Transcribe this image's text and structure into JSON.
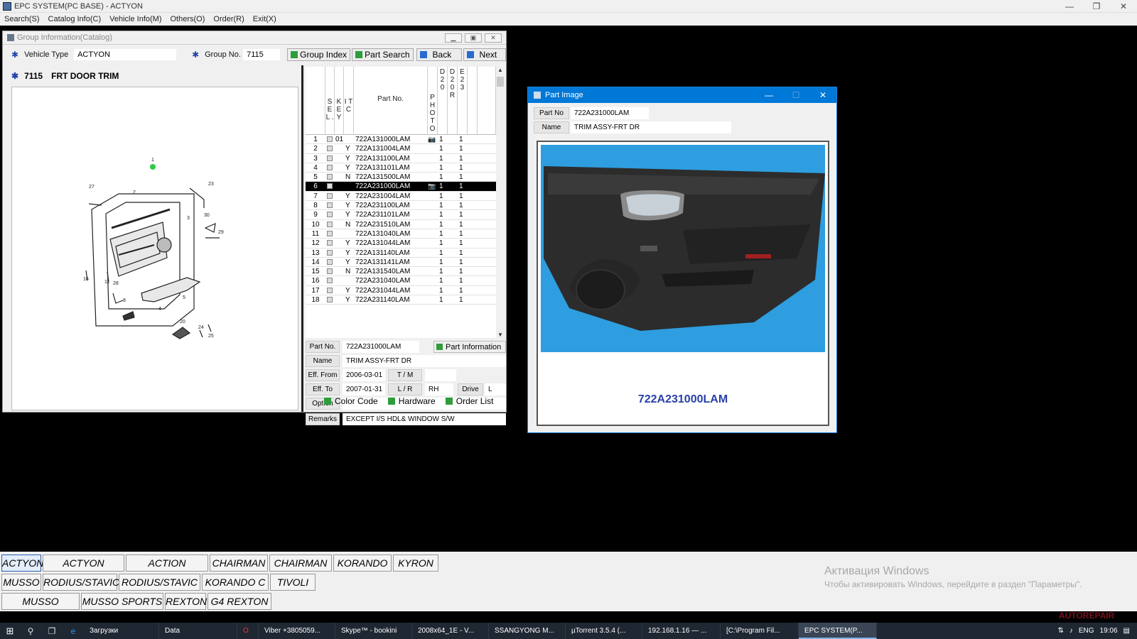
{
  "window": {
    "title": "EPC SYSTEM(PC BASE) - ACTYON",
    "controls": {
      "minimize": "—",
      "restore": "❐",
      "close": "✕"
    }
  },
  "menu": [
    "Search(S)",
    "Catalog Info(C)",
    "Vehicle Info(M)",
    "Others(O)",
    "Order(R)",
    "Exit(X)"
  ],
  "group_window": {
    "title": "Group Information(Catalog)",
    "vehicle_type_label": "Vehicle Type",
    "vehicle_type": "ACTYON",
    "group_no_label": "Group No.",
    "group_no": "7115",
    "buttons": {
      "group_index": "Group Index",
      "part_search": "Part Search",
      "back": "Back",
      "next": "Next"
    },
    "group_code": "7115",
    "group_name": "FRT DOOR TRIM",
    "diagram_labels": {
      "callout_top": "1",
      "n27": "27",
      "n2": "2",
      "n23": "23",
      "n3": "3",
      "n30": "30",
      "n29": "29",
      "n16": "16",
      "n11": "11",
      "n28": "28",
      "n8": "8",
      "n4": "4",
      "n5": "5",
      "n20": "20",
      "n24": "24",
      "n25": "25"
    }
  },
  "parts_table": {
    "headers": {
      "sel": "S E L .",
      "key": "K E Y",
      "itc": "I T C",
      "part_no": "Part No.",
      "photo": "P H O T O",
      "d20": "D 2 0",
      "d20r": "D 2 0 R",
      "e23": "E 2 3"
    },
    "rows": [
      {
        "n": "1",
        "key": "01",
        "itc": "",
        "part": "722A131000LAM",
        "photo": true,
        "d20": "1",
        "e23": "1"
      },
      {
        "n": "2",
        "key": "",
        "itc": "Y",
        "part": "722A131004LAM",
        "photo": false,
        "d20": "1",
        "e23": "1"
      },
      {
        "n": "3",
        "key": "",
        "itc": "Y",
        "part": "722A131100LAM",
        "photo": false,
        "d20": "1",
        "e23": "1"
      },
      {
        "n": "4",
        "key": "",
        "itc": "Y",
        "part": "722A131101LAM",
        "photo": false,
        "d20": "1",
        "e23": "1"
      },
      {
        "n": "5",
        "key": "",
        "itc": "N",
        "part": "722A131500LAM",
        "photo": false,
        "d20": "1",
        "e23": "1"
      },
      {
        "n": "6",
        "key": "",
        "itc": "",
        "part": "722A231000LAM",
        "photo": true,
        "d20": "1",
        "e23": "1",
        "selected": true
      },
      {
        "n": "7",
        "key": "",
        "itc": "Y",
        "part": "722A231004LAM",
        "photo": false,
        "d20": "1",
        "e23": "1"
      },
      {
        "n": "8",
        "key": "",
        "itc": "Y",
        "part": "722A231100LAM",
        "photo": false,
        "d20": "1",
        "e23": "1"
      },
      {
        "n": "9",
        "key": "",
        "itc": "Y",
        "part": "722A231101LAM",
        "photo": false,
        "d20": "1",
        "e23": "1"
      },
      {
        "n": "10",
        "key": "",
        "itc": "N",
        "part": "722A231510LAM",
        "photo": false,
        "d20": "1",
        "e23": "1"
      },
      {
        "n": "11",
        "key": "",
        "itc": "",
        "part": "722A131040LAM",
        "photo": false,
        "d20": "1",
        "e23": "1"
      },
      {
        "n": "12",
        "key": "",
        "itc": "Y",
        "part": "722A131044LAM",
        "photo": false,
        "d20": "1",
        "e23": "1"
      },
      {
        "n": "13",
        "key": "",
        "itc": "Y",
        "part": "722A131140LAM",
        "photo": false,
        "d20": "1",
        "e23": "1"
      },
      {
        "n": "14",
        "key": "",
        "itc": "Y",
        "part": "722A131141LAM",
        "photo": false,
        "d20": "1",
        "e23": "1"
      },
      {
        "n": "15",
        "key": "",
        "itc": "N",
        "part": "722A131540LAM",
        "photo": false,
        "d20": "1",
        "e23": "1"
      },
      {
        "n": "16",
        "key": "",
        "itc": "",
        "part": "722A231040LAM",
        "photo": false,
        "d20": "1",
        "e23": "1"
      },
      {
        "n": "17",
        "key": "",
        "itc": "Y",
        "part": "722A231044LAM",
        "photo": false,
        "d20": "1",
        "e23": "1"
      },
      {
        "n": "18",
        "key": "",
        "itc": "Y",
        "part": "722A231140LAM",
        "photo": false,
        "d20": "1",
        "e23": "1"
      }
    ]
  },
  "detail": {
    "part_no_label": "Part No.",
    "part_no": "722A231000LAM",
    "part_info_button": "Part Information",
    "name_label": "Name",
    "name": "TRIM ASSY-FRT DR",
    "eff_from_label": "Eff. From",
    "eff_from": "2006-03-01",
    "tm_label": "T / M",
    "tm": "",
    "eff_to_label": "Eff. To",
    "eff_to": "2007-01-31",
    "lr_label": "L / R",
    "lr": "RH",
    "drive_label": "Drive",
    "drive": "L",
    "option_label": "Option",
    "option": "",
    "remarks_label": "Remarks",
    "remarks": "EXCEPT I/S HDL& WINDOW S/W",
    "buttons": {
      "color_code": "Color Code",
      "hardware": "Hardware",
      "order_list": "Order List"
    }
  },
  "part_image_window": {
    "title": "Part Image",
    "part_no_label": "Part No",
    "part_no": "722A231000LAM",
    "name_label": "Name",
    "name": "TRIM ASSY-FRT DR",
    "caption": "722A231000LAM"
  },
  "vehicle_tabs": [
    [
      "ACTYON",
      "ACTYON SPORTS",
      "ACTION SPORTS II",
      "CHAIRMAN",
      "CHAIRMAN W",
      "KORANDO",
      "KYRON"
    ],
    [
      "MUSSO",
      "RODIUS/STAVIC",
      "RODIUS/STAVIC II",
      "KORANDO C",
      "TIVOLI"
    ],
    [
      "MUSSO SPORTS",
      "MUSSO SPORTS II",
      "REXTON",
      "G4 REXTON"
    ]
  ],
  "active_vehicle": "ACTYON",
  "watermark": {
    "line1": "Активация Windows",
    "line2": "Чтобы активировать Windows, перейдите в раздел \"Параметры\"."
  },
  "brand_watermark": "AUTOREPAIR",
  "taskbar": {
    "apps": [
      "Загрузки",
      "Data",
      "",
      "Viber +3805059...",
      "Skype™ - bookini",
      "2008x64_1E - V...",
      "SSANGYONG M...",
      "µTorrent 3.5.4 (...",
      "192.168.1.16 — ...",
      "[C:\\Program Fil...",
      "EPC SYSTEM(P..."
    ],
    "lang": "ENG",
    "time": "19:06"
  },
  "colors": {
    "accent": "#0078d7",
    "green_button": "#2e9d3a",
    "caption_blue": "#2840a8"
  }
}
